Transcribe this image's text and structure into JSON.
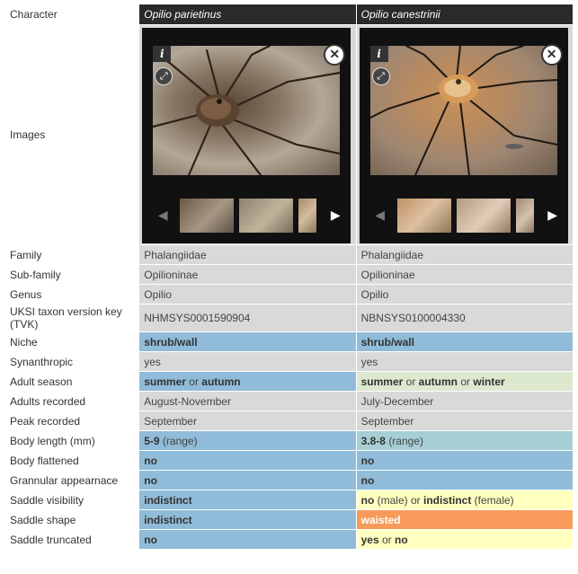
{
  "header": {
    "character_label": "Character",
    "species_1": "Opilio parietinus",
    "species_2": "Opilio canestrinii"
  },
  "images_row": {
    "label": "Images",
    "info_glyph": "i",
    "close_glyph": "✕",
    "expand_glyph": "⤢",
    "prev_glyph": "◀",
    "next_glyph": "▶",
    "icons": [
      "info-icon",
      "expand-icon",
      "close-icon",
      "chevron-left-icon",
      "chevron-right-icon"
    ]
  },
  "rows": [
    {
      "label": "Family",
      "v1": "Phalangiidae",
      "v2": "Phalangiidae"
    },
    {
      "label": "Sub-family",
      "v1": "Opilioninae",
      "v2": "Opilioninae"
    },
    {
      "label": "Genus",
      "v1": "Opilio",
      "v2": "Opilio"
    },
    {
      "label": "UKSI taxon version key (TVK)",
      "v1": "NHMSYS0001590904",
      "v2": "NBNSYS0100004330"
    },
    {
      "label": "Niche",
      "v1": "shrub/wall",
      "v2": "shrub/wall"
    },
    {
      "label": "Synanthropic",
      "v1": "yes",
      "v2": "yes"
    },
    {
      "label": "Adult season",
      "v1a": "summer",
      "v1b": "or",
      "v1c": "autumn",
      "v2a": "summer",
      "v2b": "or",
      "v2c": "autumn",
      "v2d": "or",
      "v2e": "winter"
    },
    {
      "label": "Adults recorded",
      "v1": "August-November",
      "v2": "July-December"
    },
    {
      "label": "Peak recorded",
      "v1": "September",
      "v2": "September"
    },
    {
      "label": "Body length (mm)",
      "v1a": "5-9",
      "v1b": "(range)",
      "v2a": "3.8-8",
      "v2b": "(range)"
    },
    {
      "label": "Body flattened",
      "v1": "no",
      "v2": "no"
    },
    {
      "label": "Grannular appearnace",
      "v1": "no",
      "v2": "no"
    },
    {
      "label": "Saddle visibility",
      "v1": "indistinct",
      "v2a": "no",
      "v2b": "(male) or",
      "v2c": "indistinct",
      "v2d": "(female)"
    },
    {
      "label": "Saddle shape",
      "v1": "indistinct",
      "v2": "waisted"
    },
    {
      "label": "Saddle truncated",
      "v1": "no",
      "v2a": "yes",
      "v2b": "or",
      "v2c": "no"
    }
  ],
  "colors": {
    "blue": "#90bcd9",
    "light_green": "#dce9cf",
    "teal": "#a6cfd5",
    "yellow": "#ffffc0",
    "orange": "#f79a5a",
    "grey": "#d9d9d9",
    "header_dark": "#2a2a2a"
  }
}
